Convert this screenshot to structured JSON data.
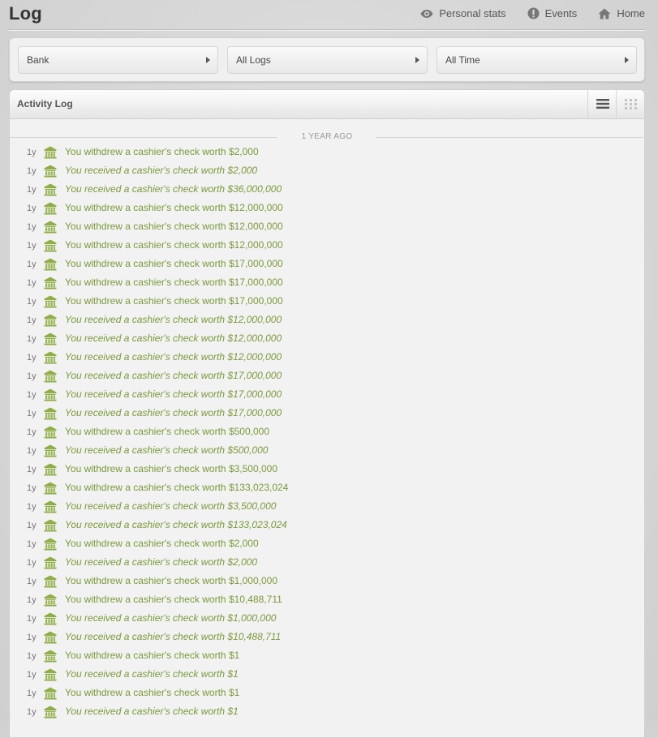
{
  "header": {
    "title": "Log",
    "links": [
      {
        "label": "Personal stats",
        "icon": "eye-icon"
      },
      {
        "label": "Events",
        "icon": "exclamation-icon"
      },
      {
        "label": "Home",
        "icon": "home-icon"
      }
    ]
  },
  "filters": [
    {
      "label": "Bank"
    },
    {
      "label": "All Logs"
    },
    {
      "label": "All Time"
    }
  ],
  "panel": {
    "title": "Activity Log",
    "separator": "1 YEAR AGO"
  },
  "colors": {
    "accent": "#7a9a3a",
    "bank_icon": "#8fae45"
  },
  "entries": [
    {
      "age": "1y",
      "text": "You withdrew a cashier's check worth $2,000",
      "type": "withdrew"
    },
    {
      "age": "1y",
      "text": "You received a cashier's check worth $2,000",
      "type": "received"
    },
    {
      "age": "1y",
      "text": "You received a cashier's check worth $36,000,000",
      "type": "received"
    },
    {
      "age": "1y",
      "text": "You withdrew a cashier's check worth $12,000,000",
      "type": "withdrew"
    },
    {
      "age": "1y",
      "text": "You withdrew a cashier's check worth $12,000,000",
      "type": "withdrew"
    },
    {
      "age": "1y",
      "text": "You withdrew a cashier's check worth $12,000,000",
      "type": "withdrew"
    },
    {
      "age": "1y",
      "text": "You withdrew a cashier's check worth $17,000,000",
      "type": "withdrew"
    },
    {
      "age": "1y",
      "text": "You withdrew a cashier's check worth $17,000,000",
      "type": "withdrew"
    },
    {
      "age": "1y",
      "text": "You withdrew a cashier's check worth $17,000,000",
      "type": "withdrew"
    },
    {
      "age": "1y",
      "text": "You received a cashier's check worth $12,000,000",
      "type": "received"
    },
    {
      "age": "1y",
      "text": "You received a cashier's check worth $12,000,000",
      "type": "received"
    },
    {
      "age": "1y",
      "text": "You received a cashier's check worth $12,000,000",
      "type": "received"
    },
    {
      "age": "1y",
      "text": "You received a cashier's check worth $17,000,000",
      "type": "received"
    },
    {
      "age": "1y",
      "text": "You received a cashier's check worth $17,000,000",
      "type": "received"
    },
    {
      "age": "1y",
      "text": "You received a cashier's check worth $17,000,000",
      "type": "received"
    },
    {
      "age": "1y",
      "text": "You withdrew a cashier's check worth $500,000",
      "type": "withdrew"
    },
    {
      "age": "1y",
      "text": "You received a cashier's check worth $500,000",
      "type": "received"
    },
    {
      "age": "1y",
      "text": "You withdrew a cashier's check worth $3,500,000",
      "type": "withdrew"
    },
    {
      "age": "1y",
      "text": "You withdrew a cashier's check worth $133,023,024",
      "type": "withdrew"
    },
    {
      "age": "1y",
      "text": "You received a cashier's check worth $3,500,000",
      "type": "received"
    },
    {
      "age": "1y",
      "text": "You received a cashier's check worth $133,023,024",
      "type": "received"
    },
    {
      "age": "1y",
      "text": "You withdrew a cashier's check worth $2,000",
      "type": "withdrew"
    },
    {
      "age": "1y",
      "text": "You received a cashier's check worth $2,000",
      "type": "received"
    },
    {
      "age": "1y",
      "text": "You withdrew a cashier's check worth $1,000,000",
      "type": "withdrew"
    },
    {
      "age": "1y",
      "text": "You withdrew a cashier's check worth $10,488,711",
      "type": "withdrew"
    },
    {
      "age": "1y",
      "text": "You received a cashier's check worth $1,000,000",
      "type": "received"
    },
    {
      "age": "1y",
      "text": "You received a cashier's check worth $10,488,711",
      "type": "received"
    },
    {
      "age": "1y",
      "text": "You withdrew a cashier's check worth $1",
      "type": "withdrew"
    },
    {
      "age": "1y",
      "text": "You received a cashier's check worth $1",
      "type": "received"
    },
    {
      "age": "1y",
      "text": "You withdrew a cashier's check worth $1",
      "type": "withdrew"
    },
    {
      "age": "1y",
      "text": "You received a cashier's check worth $1",
      "type": "received"
    }
  ]
}
